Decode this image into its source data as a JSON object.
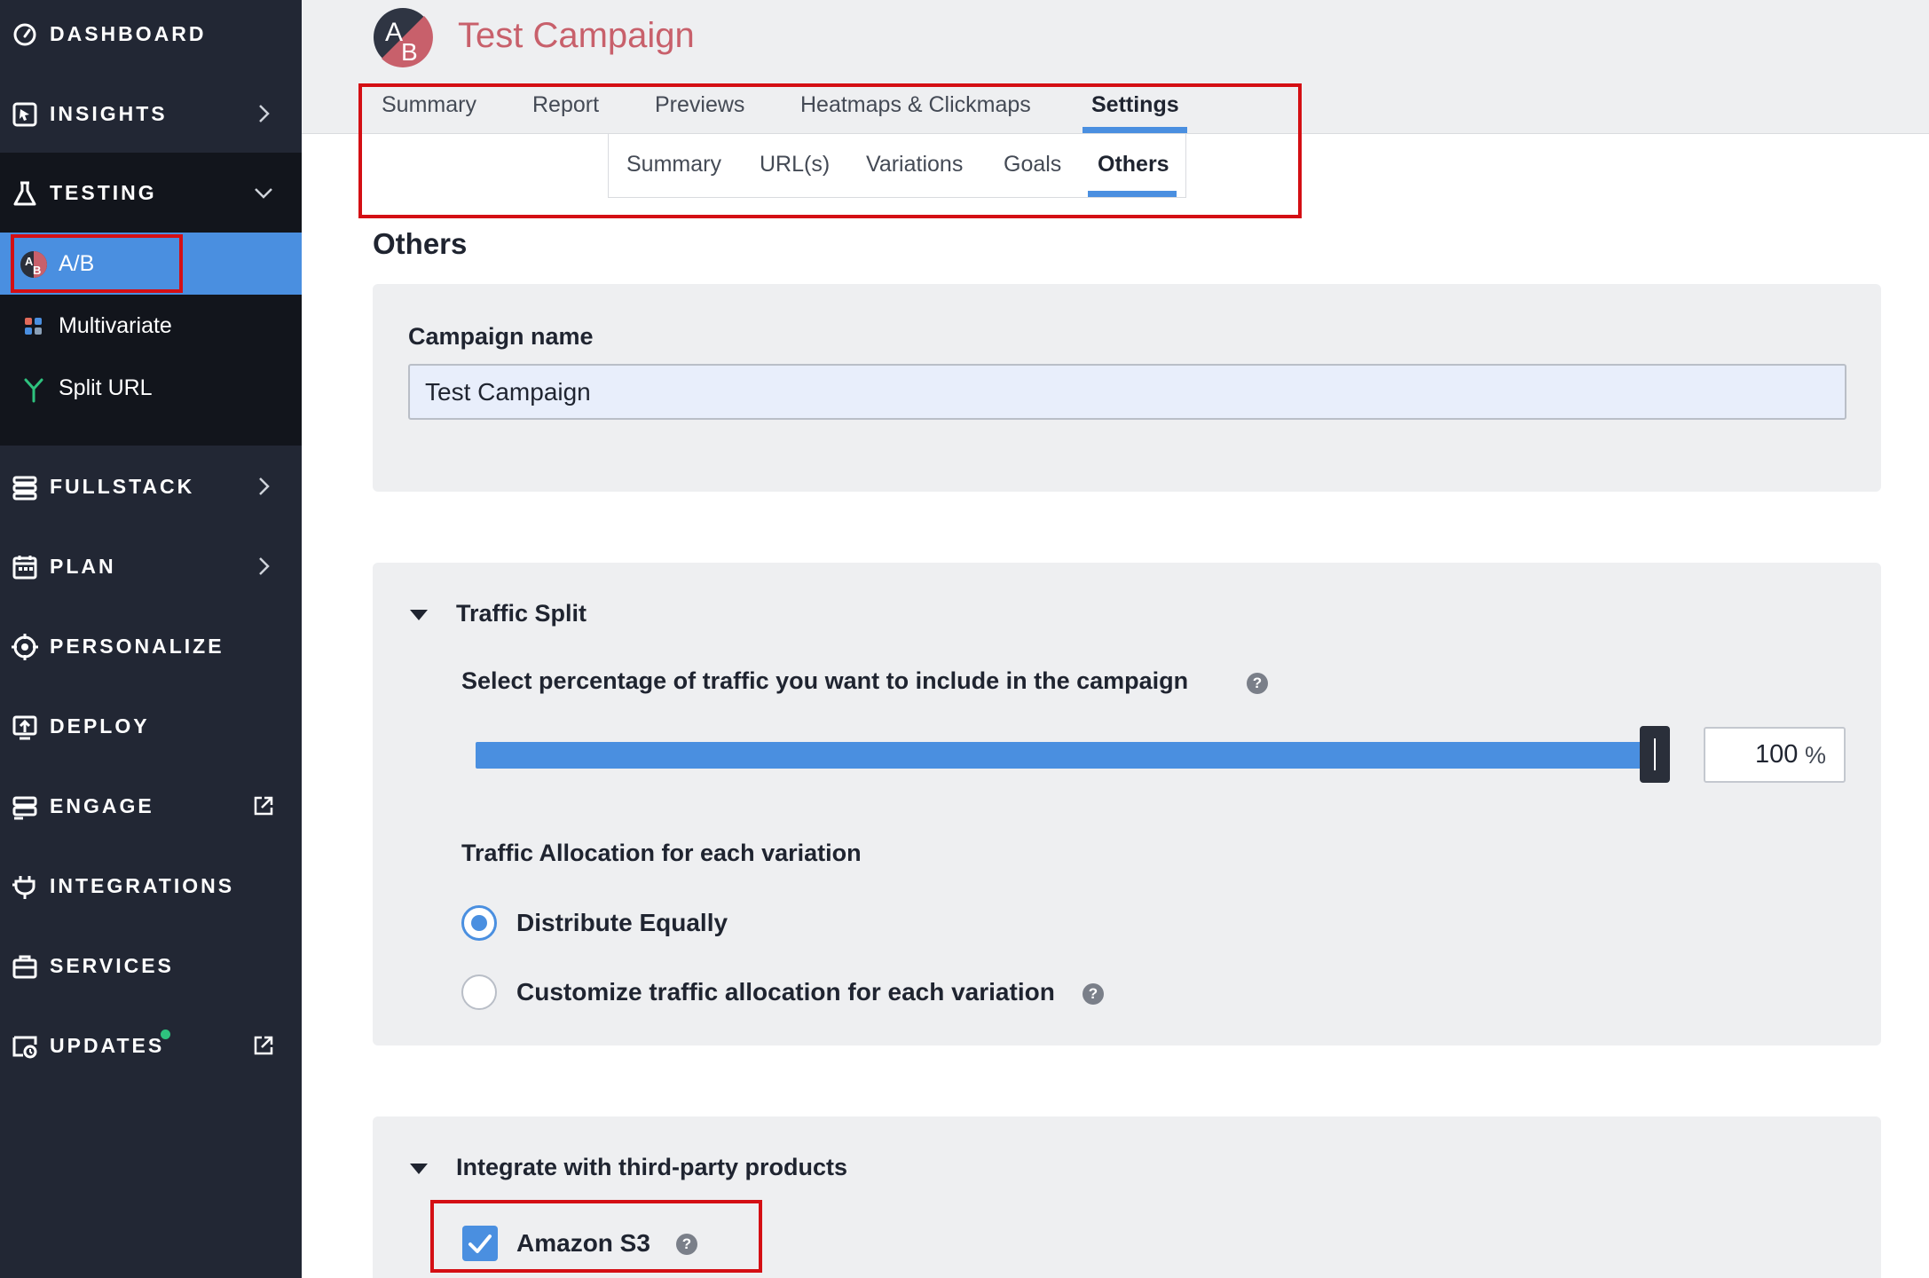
{
  "sidebar": {
    "items": [
      {
        "label": "DASHBOARD",
        "icon": "dashboard-icon"
      },
      {
        "label": "INSIGHTS",
        "icon": "insights-icon"
      },
      {
        "label": "TESTING",
        "icon": "flask-icon"
      },
      {
        "label": "FULLSTACK",
        "icon": "fullstack-icon"
      },
      {
        "label": "PLAN",
        "icon": "calendar-icon"
      },
      {
        "label": "PERSONALIZE",
        "icon": "target-icon"
      },
      {
        "label": "DEPLOY",
        "icon": "deploy-icon"
      },
      {
        "label": "ENGAGE",
        "icon": "engage-icon"
      },
      {
        "label": "INTEGRATIONS",
        "icon": "plug-icon"
      },
      {
        "label": "SERVICES",
        "icon": "briefcase-icon"
      },
      {
        "label": "UPDATES",
        "icon": "updates-icon"
      }
    ],
    "testing_sub": [
      {
        "label": "A/B",
        "icon": "ab-icon"
      },
      {
        "label": "Multivariate",
        "icon": "multivariate-icon"
      },
      {
        "label": "Split URL",
        "icon": "split-url-icon"
      }
    ]
  },
  "header": {
    "campaign_title": "Test Campaign",
    "logo_letters": {
      "a": "A",
      "b": "B"
    },
    "tabs": [
      "Summary",
      "Report",
      "Previews",
      "Heatmaps & Clickmaps",
      "Settings"
    ],
    "subtabs": [
      "Summary",
      "URL(s)",
      "Variations",
      "Goals",
      "Others"
    ]
  },
  "main": {
    "section_title": "Others",
    "campaign_name": {
      "label": "Campaign name",
      "value": "Test Campaign"
    },
    "traffic_split": {
      "title": "Traffic Split",
      "question": "Select percentage of traffic you want to include in the campaign",
      "percent_value": "100",
      "percent_sign": "%",
      "percent_fraction": 1.0,
      "allocation_title": "Traffic Allocation for each variation",
      "option_equal": "Distribute Equally",
      "option_custom": "Customize traffic allocation for each variation"
    },
    "integrations": {
      "title": "Integrate with third-party products",
      "amazon_s3": "Amazon S3"
    },
    "help_glyph": "?"
  },
  "colors": {
    "sidebar_bg": "#222734",
    "sidebar_sub_bg": "#12151c",
    "accent": "#4a8fe0",
    "title": "#c8606b",
    "annotation": "#d40f14"
  }
}
